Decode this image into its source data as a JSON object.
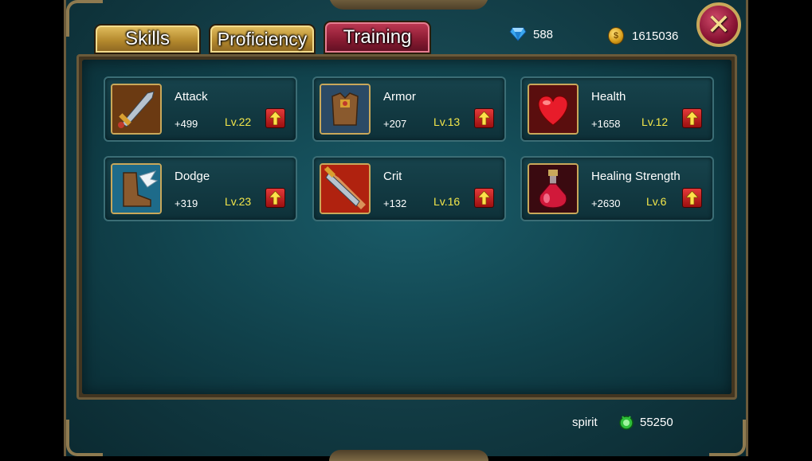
{
  "tabs": [
    {
      "label": "Skills",
      "active": false
    },
    {
      "label": "Proficiency",
      "active": false
    },
    {
      "label": "Training",
      "active": true
    }
  ],
  "currency": {
    "gems": "588",
    "gold": "1615036"
  },
  "skills": [
    {
      "name": "Attack",
      "value": "+499",
      "level": "Lv.22",
      "icon": "sword-icon"
    },
    {
      "name": "Armor",
      "value": "+207",
      "level": "Lv.13",
      "icon": "armor-icon"
    },
    {
      "name": "Health",
      "value": "+1658",
      "level": "Lv.12",
      "icon": "heart-icon"
    },
    {
      "name": "Dodge",
      "value": "+319",
      "level": "Lv.23",
      "icon": "winged-boot-icon"
    },
    {
      "name": "Crit",
      "value": "+132",
      "level": "Lv.16",
      "icon": "crit-blade-icon"
    },
    {
      "name": "Healing Strength",
      "value": "+2630",
      "level": "Lv.6",
      "icon": "potion-icon"
    }
  ],
  "footer": {
    "spirit_label": "spirit",
    "spirit_value": "55250"
  },
  "colors": {
    "level_text": "#f3e64a",
    "upgrade_button": "#c81f1f",
    "active_tab": "#8c1c33",
    "inactive_tab": "#b58a2e"
  }
}
